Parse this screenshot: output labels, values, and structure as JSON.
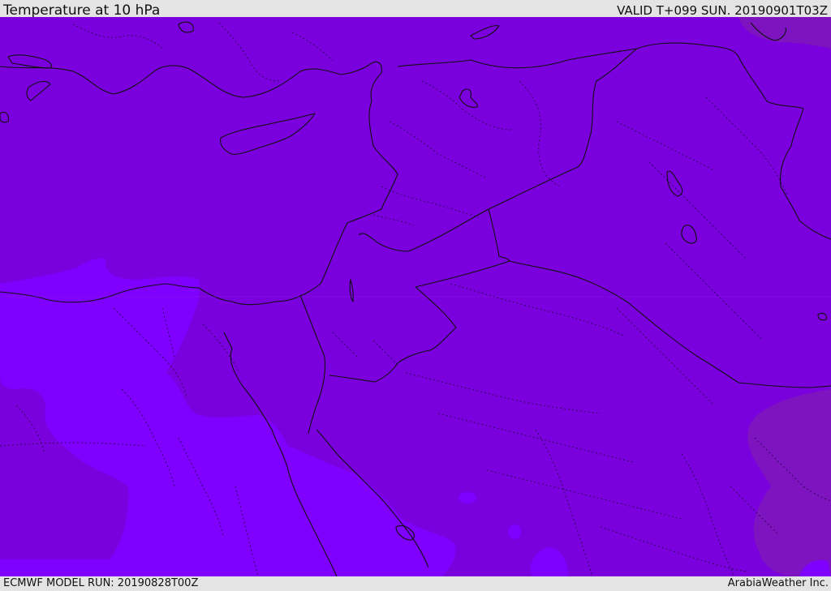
{
  "header": {
    "title": "Temperature at 10 hPa",
    "valid": "VALID T+099 SUN. 20190901T03Z"
  },
  "footer": {
    "model_run": "ECMWF MODEL RUN: 20190828T00Z",
    "credit": "ArabiaWeather Inc."
  },
  "colors": {
    "field_dominant": "#7a00dd",
    "field_light": "#7f00ff",
    "field_warm": "#7d14c0",
    "page_background": "#e4e4e4",
    "borders": "#111111"
  }
}
